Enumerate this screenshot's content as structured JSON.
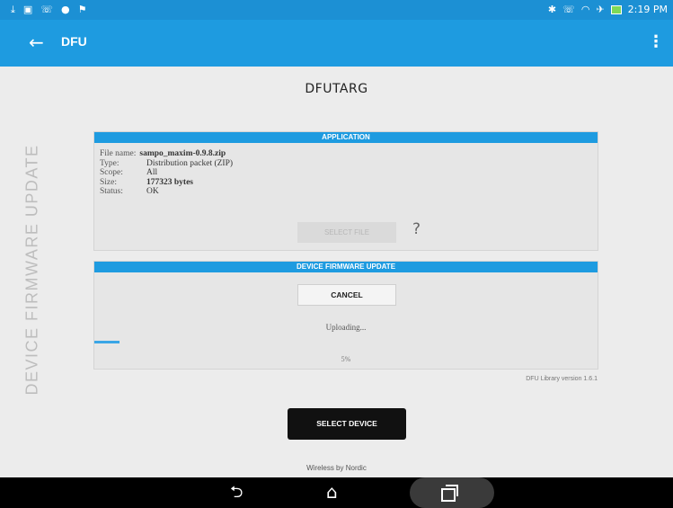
{
  "status_bar": {
    "left_icons": [
      "download-icon",
      "gallery-icon",
      "phone-icon",
      "location-icon",
      "flag-icon"
    ],
    "right_icons": [
      "bluetooth-icon",
      "phone-icon",
      "wifi-icon",
      "airplane-icon",
      "battery-icon"
    ],
    "time": "2:19 PM"
  },
  "app_bar": {
    "title": "DFU",
    "color": "#1e9be0"
  },
  "device_name": "DFUTARG",
  "vertical_label": "DEVICE FIRMWARE UPDATE",
  "application_panel": {
    "header": "APPLICATION",
    "file_name_label": "File name:",
    "file_name": "sampo_maxim-0.9.8.zip",
    "type_label": "Type:",
    "type": "Distribution packet (ZIP)",
    "scope_label": "Scope:",
    "scope": "All",
    "size_label": "Size:",
    "size": "177323 bytes",
    "status_label": "Status:",
    "status": "OK",
    "select_file_label": "SELECT FILE",
    "help": "?"
  },
  "dfu_panel": {
    "header": "DEVICE FIRMWARE UPDATE",
    "cancel_label": "CANCEL",
    "uploading_text": "Uploading...",
    "progress_percent": 5,
    "percent_text": "5%"
  },
  "library_version": "DFU Library version 1.6.1",
  "select_device_label": "SELECT DEVICE",
  "footer": "Wireless by Nordic",
  "nav_bar": {
    "icons": [
      "back-icon",
      "home-icon",
      "recents-icon"
    ]
  }
}
